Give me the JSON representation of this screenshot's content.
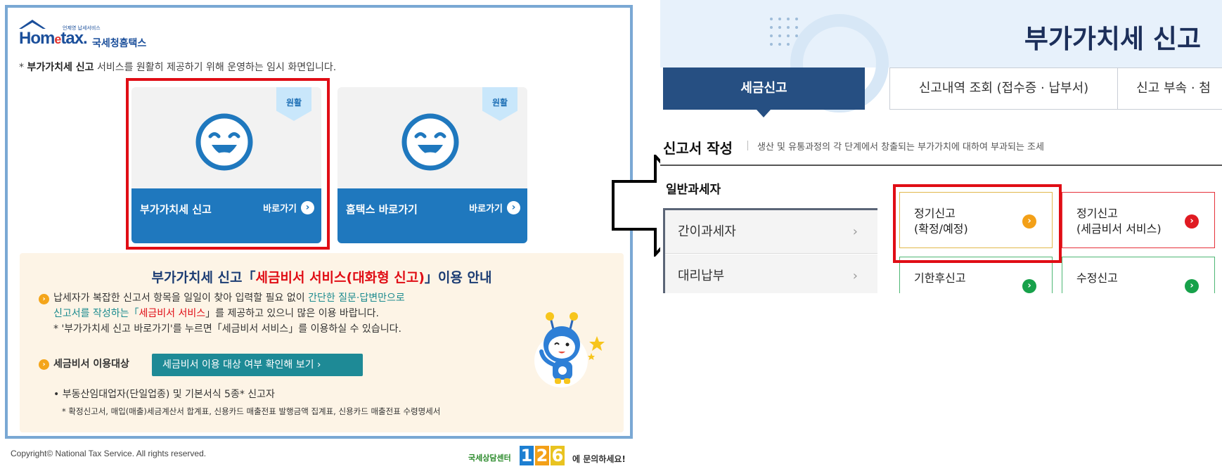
{
  "left": {
    "logo": {
      "brand": "Hometax",
      "sub": "국세청홈택스",
      "tiny": "언제영 납세서비스"
    },
    "notice": {
      "bold": "부가가치세 신고",
      "rest": " 서비스를 원활히 제공하기 위해 운영하는 임시 화면입니다.",
      "prefix": "* "
    },
    "cards": [
      {
        "badge": "원활",
        "title": "부가가치세 신고",
        "go": "바로가기"
      },
      {
        "badge": "원활",
        "title": "홈택스 바로가기",
        "go": "바로가기"
      }
    ],
    "guide": {
      "title_a": "부가가치세 신고「",
      "title_red": "세금비서 서비스(대화형 신고)",
      "title_b": "」이용 안내",
      "p1_a": "납세자가 복잡한 신고서 항목을 일일이 찾아 입력할 필요 없이 ",
      "p1_teal": "간단한 질문·답변만으로",
      "p1_teal2": "신고서를 작성하는「",
      "p1_red": "세금비서 서비스",
      "p1_b": "」를 제공하고 있으니 많은 이용 바랍니다.",
      "p1_note": "* '부가가치세 신고 바로가기'를 누르면「세금비서 서비스」를 이용하실 수 있습니다.",
      "target_label": "세금비서 이용대상",
      "target_button": "세금비서 이용 대상 여부 확인해 보기  ›",
      "target_item": "• 부동산임대업자(단일업종) 및 기본서식 5종* 신고자",
      "target_note": "* 확정신고서, 매입(매출)세금계산서 합계표, 신용카드 매출전표 발행금액 집계표, 신용카드 매출전표 수령명세서"
    },
    "footer": {
      "copyright": "Copyright© National Tax Service. All rights reserved.",
      "center_label": "국세상담센터",
      "center_digits": [
        "1",
        "2",
        "6"
      ],
      "center_tail": "에 문의하세요!"
    }
  },
  "right": {
    "title": "부가가치세 신고",
    "tabs": [
      "세금신고",
      "신고내역 조회 (접수증 · 납부서)",
      "신고 부속 · 첨"
    ],
    "section_title": "신고서 작성",
    "section_desc": "생산 및 유통과정의 각 단계에서 창출되는 부가가치에 대하여 부과되는 조세",
    "taxpayer_type": "일반과세자",
    "sidebar": [
      "간이과세자",
      "대리납부"
    ],
    "buttons": [
      {
        "line1": "정기신고",
        "line2": "(확정/예정)",
        "icon": "›",
        "color": "#f3a018"
      },
      {
        "line1": "정기신고",
        "line2": "(세금비서 서비스)",
        "icon": "›",
        "color": "#e01a22"
      },
      {
        "line1": "기한후신고",
        "line2": "",
        "icon": "›",
        "color": "#17a14a"
      },
      {
        "line1": "수정신고",
        "line2": "",
        "icon": "›",
        "color": "#17a14a"
      }
    ]
  },
  "colors": {
    "brand_blue": "#1f78be",
    "highlight_red": "#e00d15",
    "navy_tab": "#264f82",
    "guide_bg": "#fdf4e6"
  }
}
